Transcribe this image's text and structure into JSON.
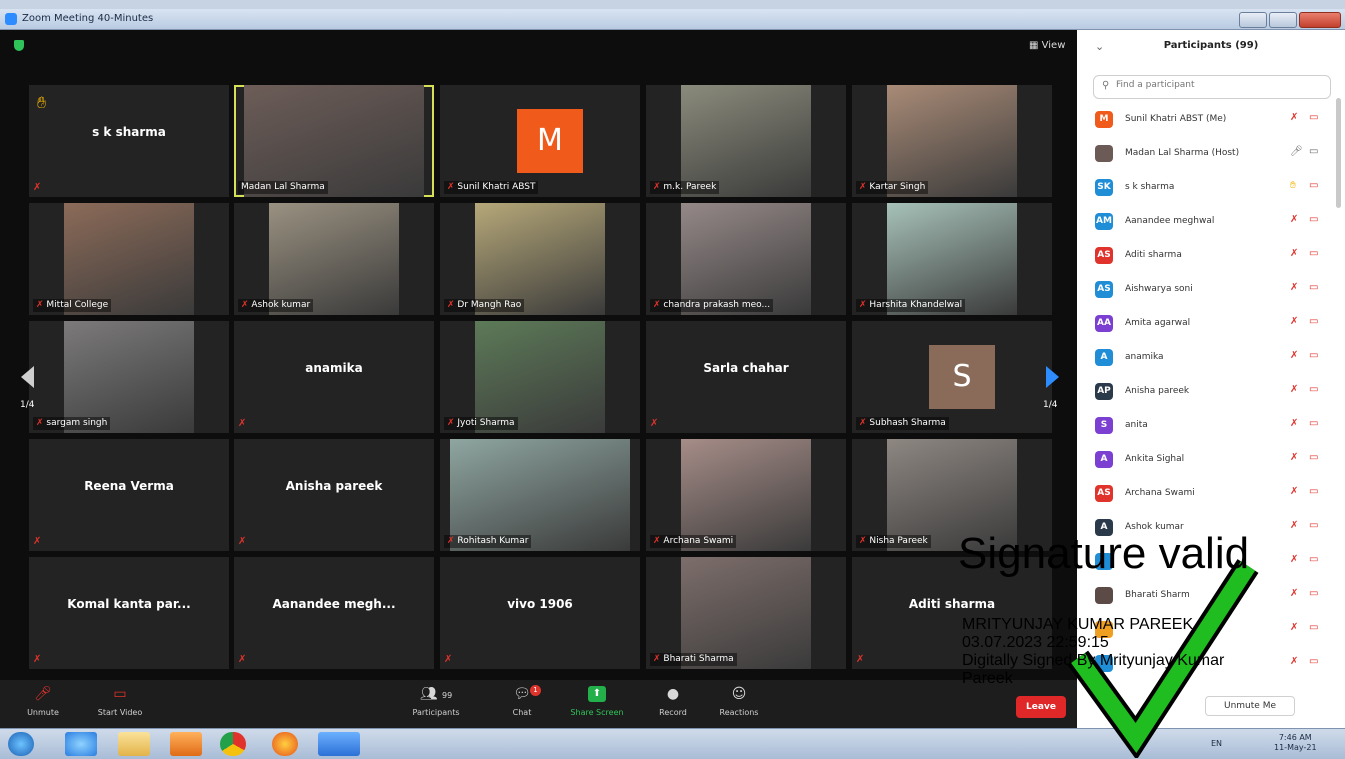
{
  "window": {
    "title": "Zoom Meeting 40-Minutes"
  },
  "main": {
    "view_label": "View",
    "pager_left": "1/4",
    "pager_right": "1/4"
  },
  "tiles": [
    {
      "name": "s k sharma",
      "label": "",
      "video": false,
      "hand": true
    },
    {
      "name": "",
      "label": "Madan Lal Sharma",
      "video": true,
      "active": true,
      "bg": "#6d5d58"
    },
    {
      "name": "",
      "label": "Sunil Khatri ABST",
      "avatar": "M",
      "avatar_color": "#f05a1b"
    },
    {
      "name": "",
      "label": "m.k. Pareek",
      "video": true,
      "bg": "#8b8b7c"
    },
    {
      "name": "",
      "label": "Kartar Singh",
      "video": true,
      "bg": "#a98b77"
    },
    {
      "name": "",
      "label": "Mittal College",
      "video": true,
      "bg": "#8c6b59"
    },
    {
      "name": "",
      "label": "Ashok kumar",
      "video": true,
      "bg": "#9a9181"
    },
    {
      "name": "",
      "label": "Dr Mangh Rao",
      "video": true,
      "bg": "#b6a879"
    },
    {
      "name": "",
      "label": "chandra prakash meo...",
      "video": true,
      "bg": "#958988"
    },
    {
      "name": "",
      "label": "Harshita Khandelwal",
      "video": true,
      "bg": "#a7c2b8"
    },
    {
      "name": "",
      "label": "sargam singh",
      "video": true,
      "bg": "#7c7a7a"
    },
    {
      "name": "anamika",
      "label": "",
      "video": false
    },
    {
      "name": "",
      "label": "Jyoti Sharma",
      "video": true,
      "bg": "#5d7a58"
    },
    {
      "name": "Sarla chahar",
      "label": "",
      "video": false
    },
    {
      "name": "",
      "label": "Subhash Sharma",
      "avatar": "S",
      "avatar_color": "#8a6b5a"
    },
    {
      "name": "Reena Verma",
      "label": "",
      "video": false
    },
    {
      "name": "Anisha pareek",
      "label": "",
      "video": false
    },
    {
      "name": "",
      "label": "Rohitash Kumar",
      "video": true,
      "bg": "#8fa6a1"
    },
    {
      "name": "",
      "label": "Archana Swami",
      "video": true,
      "bg": "#a68d88"
    },
    {
      "name": "",
      "label": "Nisha Pareek",
      "video": true,
      "bg": "#8e8782"
    },
    {
      "name": "Komal kanta par...",
      "label": "",
      "video": false
    },
    {
      "name": "Aanandee megh...",
      "label": "",
      "video": false
    },
    {
      "name": "vivo 1906",
      "label": "",
      "video": false
    },
    {
      "name": "",
      "label": "Bharati Sharma",
      "video": true,
      "bg": "#7d6e6b"
    },
    {
      "name": "Aditi sharma",
      "label": "",
      "video": false
    }
  ],
  "toolbar": {
    "unmute": "Unmute",
    "start_video": "Start Video",
    "participants": "Participants",
    "participants_count": "99",
    "chat": "Chat",
    "chat_badge": "1",
    "share_screen": "Share Screen",
    "record": "Record",
    "reactions": "Reactions",
    "leave": "Leave"
  },
  "panel": {
    "title": "Participants (99)",
    "search_placeholder": "Find a participant",
    "unmute_me": "Unmute Me",
    "participants": [
      {
        "initials": "M",
        "name": "Sunil Khatri ABST (Me)",
        "color": "#f05a1b"
      },
      {
        "initials": "",
        "name": "Madan Lal Sharma (Host)",
        "color": "#6b5a55",
        "host": true
      },
      {
        "initials": "SK",
        "name": "s k sharma",
        "color": "#1f8ed6",
        "hand": true
      },
      {
        "initials": "AM",
        "name": "Aanandee meghwal",
        "color": "#1f8ed6"
      },
      {
        "initials": "AS",
        "name": "Aditi sharma",
        "color": "#e0332b"
      },
      {
        "initials": "AS",
        "name": "Aishwarya soni",
        "color": "#1f8ed6"
      },
      {
        "initials": "AA",
        "name": "Amita agarwal",
        "color": "#7b3fd1"
      },
      {
        "initials": "A",
        "name": "anamika",
        "color": "#1f8ed6"
      },
      {
        "initials": "AP",
        "name": "Anisha pareek",
        "color": "#2b3a4a"
      },
      {
        "initials": "S",
        "name": "anita",
        "color": "#7b3fd1"
      },
      {
        "initials": "A",
        "name": "Ankita Sighal",
        "color": "#7b3fd1"
      },
      {
        "initials": "AS",
        "name": "Archana Swami",
        "color": "#e0332b"
      },
      {
        "initials": "A",
        "name": "Ashok kumar",
        "color": "#2b3a4a"
      },
      {
        "initials": "",
        "name": "",
        "color": "#1f8ed6"
      },
      {
        "initials": "",
        "name": "Bharati Sharm",
        "color": "#5b4a45"
      },
      {
        "initials": "",
        "name": "",
        "color": "#f0a020"
      },
      {
        "initials": "",
        "name": "",
        "color": "#1f8ed6"
      }
    ]
  },
  "taskbar": {
    "lang": "EN",
    "time": "7:46 AM",
    "date": "11-May-21"
  },
  "signature": {
    "title": "Signature valid",
    "name": "MRITYUNJAY KUMAR PAREEK",
    "datetime": "03.07.2023 22:59:15",
    "line1": "Digitally Signed By Mrityunjay Kumar",
    "line2": "Pareek"
  }
}
